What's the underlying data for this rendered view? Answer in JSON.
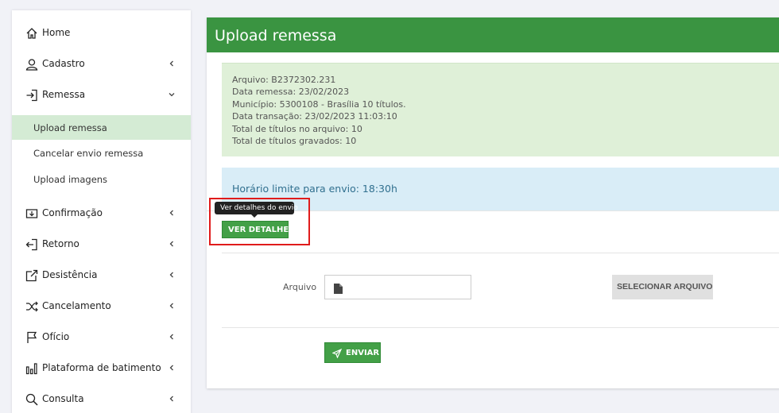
{
  "sidebar": {
    "items": [
      {
        "label": "Home",
        "icon": "home-icon"
      },
      {
        "label": "Cadastro",
        "icon": "user-icon"
      },
      {
        "label": "Remessa",
        "icon": "sign-in-icon"
      },
      {
        "label": "Confirmação",
        "icon": "download-box-icon"
      },
      {
        "label": "Retorno",
        "icon": "sign-out-icon"
      },
      {
        "label": "Desistência",
        "icon": "share-box-icon"
      },
      {
        "label": "Cancelamento",
        "icon": "shuffle-icon"
      },
      {
        "label": "Ofício",
        "icon": "flag-icon"
      },
      {
        "label": "Plataforma de batimento",
        "icon": "bar-chart-icon"
      },
      {
        "label": "Consulta",
        "icon": "search-icon"
      }
    ],
    "subitems": [
      {
        "label": "Upload remessa",
        "active": true
      },
      {
        "label": "Cancelar envio remessa",
        "active": false
      },
      {
        "label": "Upload imagens",
        "active": false
      }
    ]
  },
  "card": {
    "title": "Upload remessa",
    "info": {
      "arquivo": "Arquivo: B2372302.231",
      "data_remessa": "Data remessa: 23/02/2023",
      "municipio": "Município: 5300108 - Brasília 10 títulos.",
      "data_transacao": "Data transação: 23/02/2023 11:03:10",
      "total_arquivo": "Total de títulos no arquivo: 10",
      "total_gravados": "Total de títulos gravados: 10"
    },
    "horario": "Horário limite para envio:  18:30h",
    "tooltip": "Ver detalhes do envio",
    "ver_detalhes_label": "VER DETALHES",
    "file": {
      "label": "Arquivo",
      "value": "",
      "select_label": "SELECIONAR ARQUIVO"
    },
    "enviar_label": "ENVIAR"
  },
  "colors": {
    "header_green": "#3a9441",
    "button_green": "#43a047",
    "info_bg": "#dff0d8",
    "time_bg": "#d9edf7",
    "active_sub_bg": "#d4ebd4",
    "highlight_red": "#e01b1b"
  }
}
